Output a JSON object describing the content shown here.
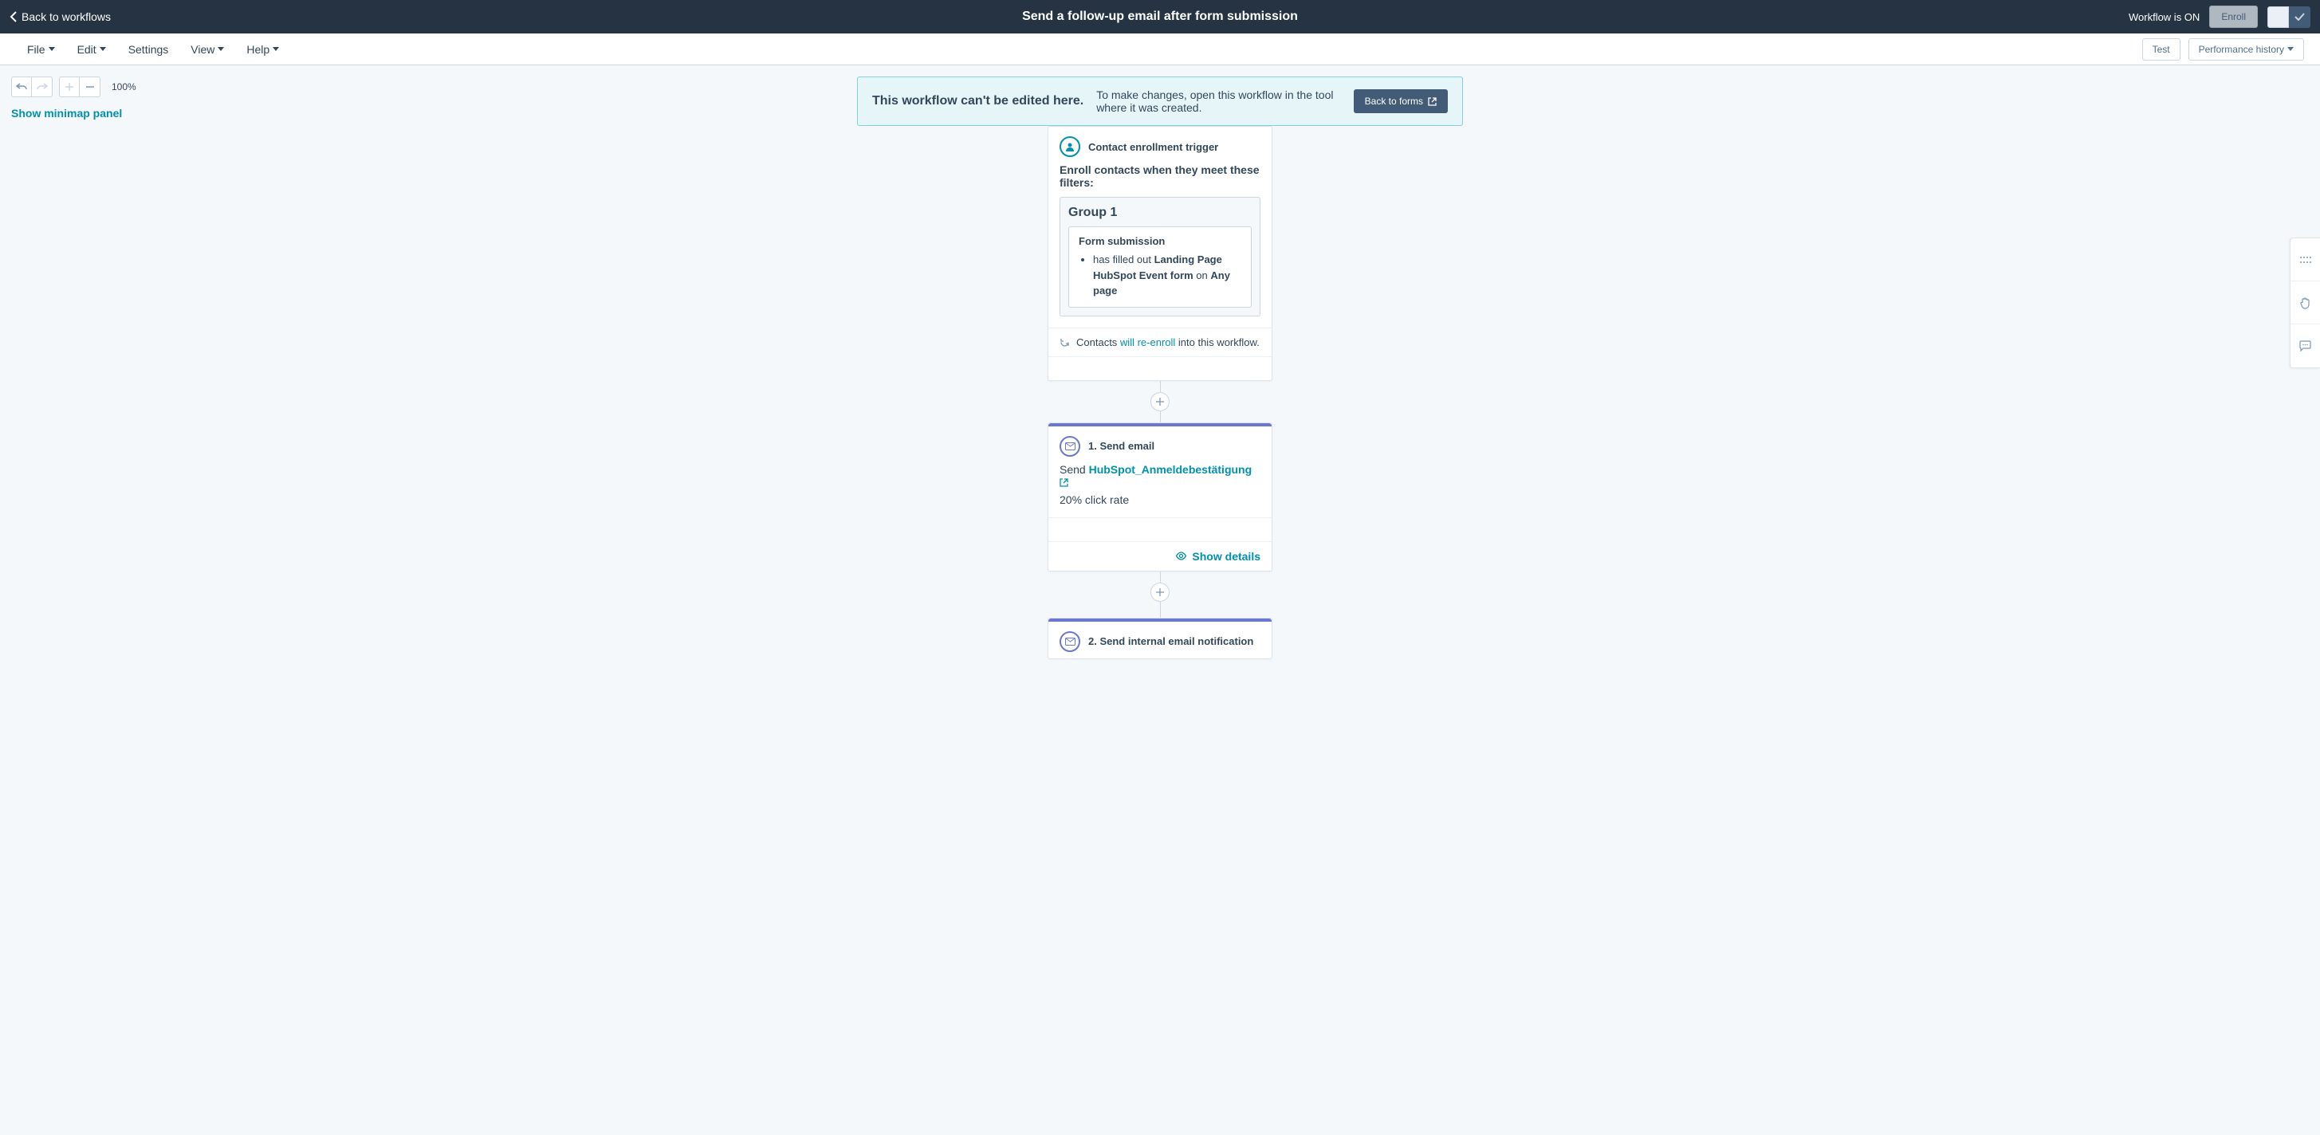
{
  "header": {
    "back_label": "Back to workflows",
    "title": "Send a follow-up email after form submission",
    "status": "Workflow is ON",
    "enroll_label": "Enroll"
  },
  "menu": {
    "file": "File",
    "edit": "Edit",
    "settings": "Settings",
    "view": "View",
    "help": "Help",
    "test": "Test",
    "performance": "Performance history"
  },
  "toolbar": {
    "zoom": "100%",
    "minimap": "Show minimap panel"
  },
  "alert": {
    "title": "This workflow can't be edited here.",
    "text": "To make changes, open this workflow in the tool where it was created.",
    "button": "Back to forms"
  },
  "trigger": {
    "title": "Contact enrollment trigger",
    "enroll_text": "Enroll contacts when they meet these filters:",
    "group_title": "Group 1",
    "filter_title": "Form submission",
    "filter_prefix": "has filled out ",
    "filter_form": "Landing Page HubSpot Event form",
    "filter_on": " on ",
    "filter_page": "Any page",
    "reenroll_prefix": "Contacts ",
    "reenroll_link": "will re-enroll",
    "reenroll_suffix": " into this workflow."
  },
  "step1": {
    "title": "1. Send email",
    "send_prefix": "Send ",
    "email_name": "HubSpot_Anmeldebestätigung",
    "click_rate": "20% click rate",
    "show_details": "Show details"
  },
  "step2": {
    "title": "2. Send internal email notification"
  }
}
